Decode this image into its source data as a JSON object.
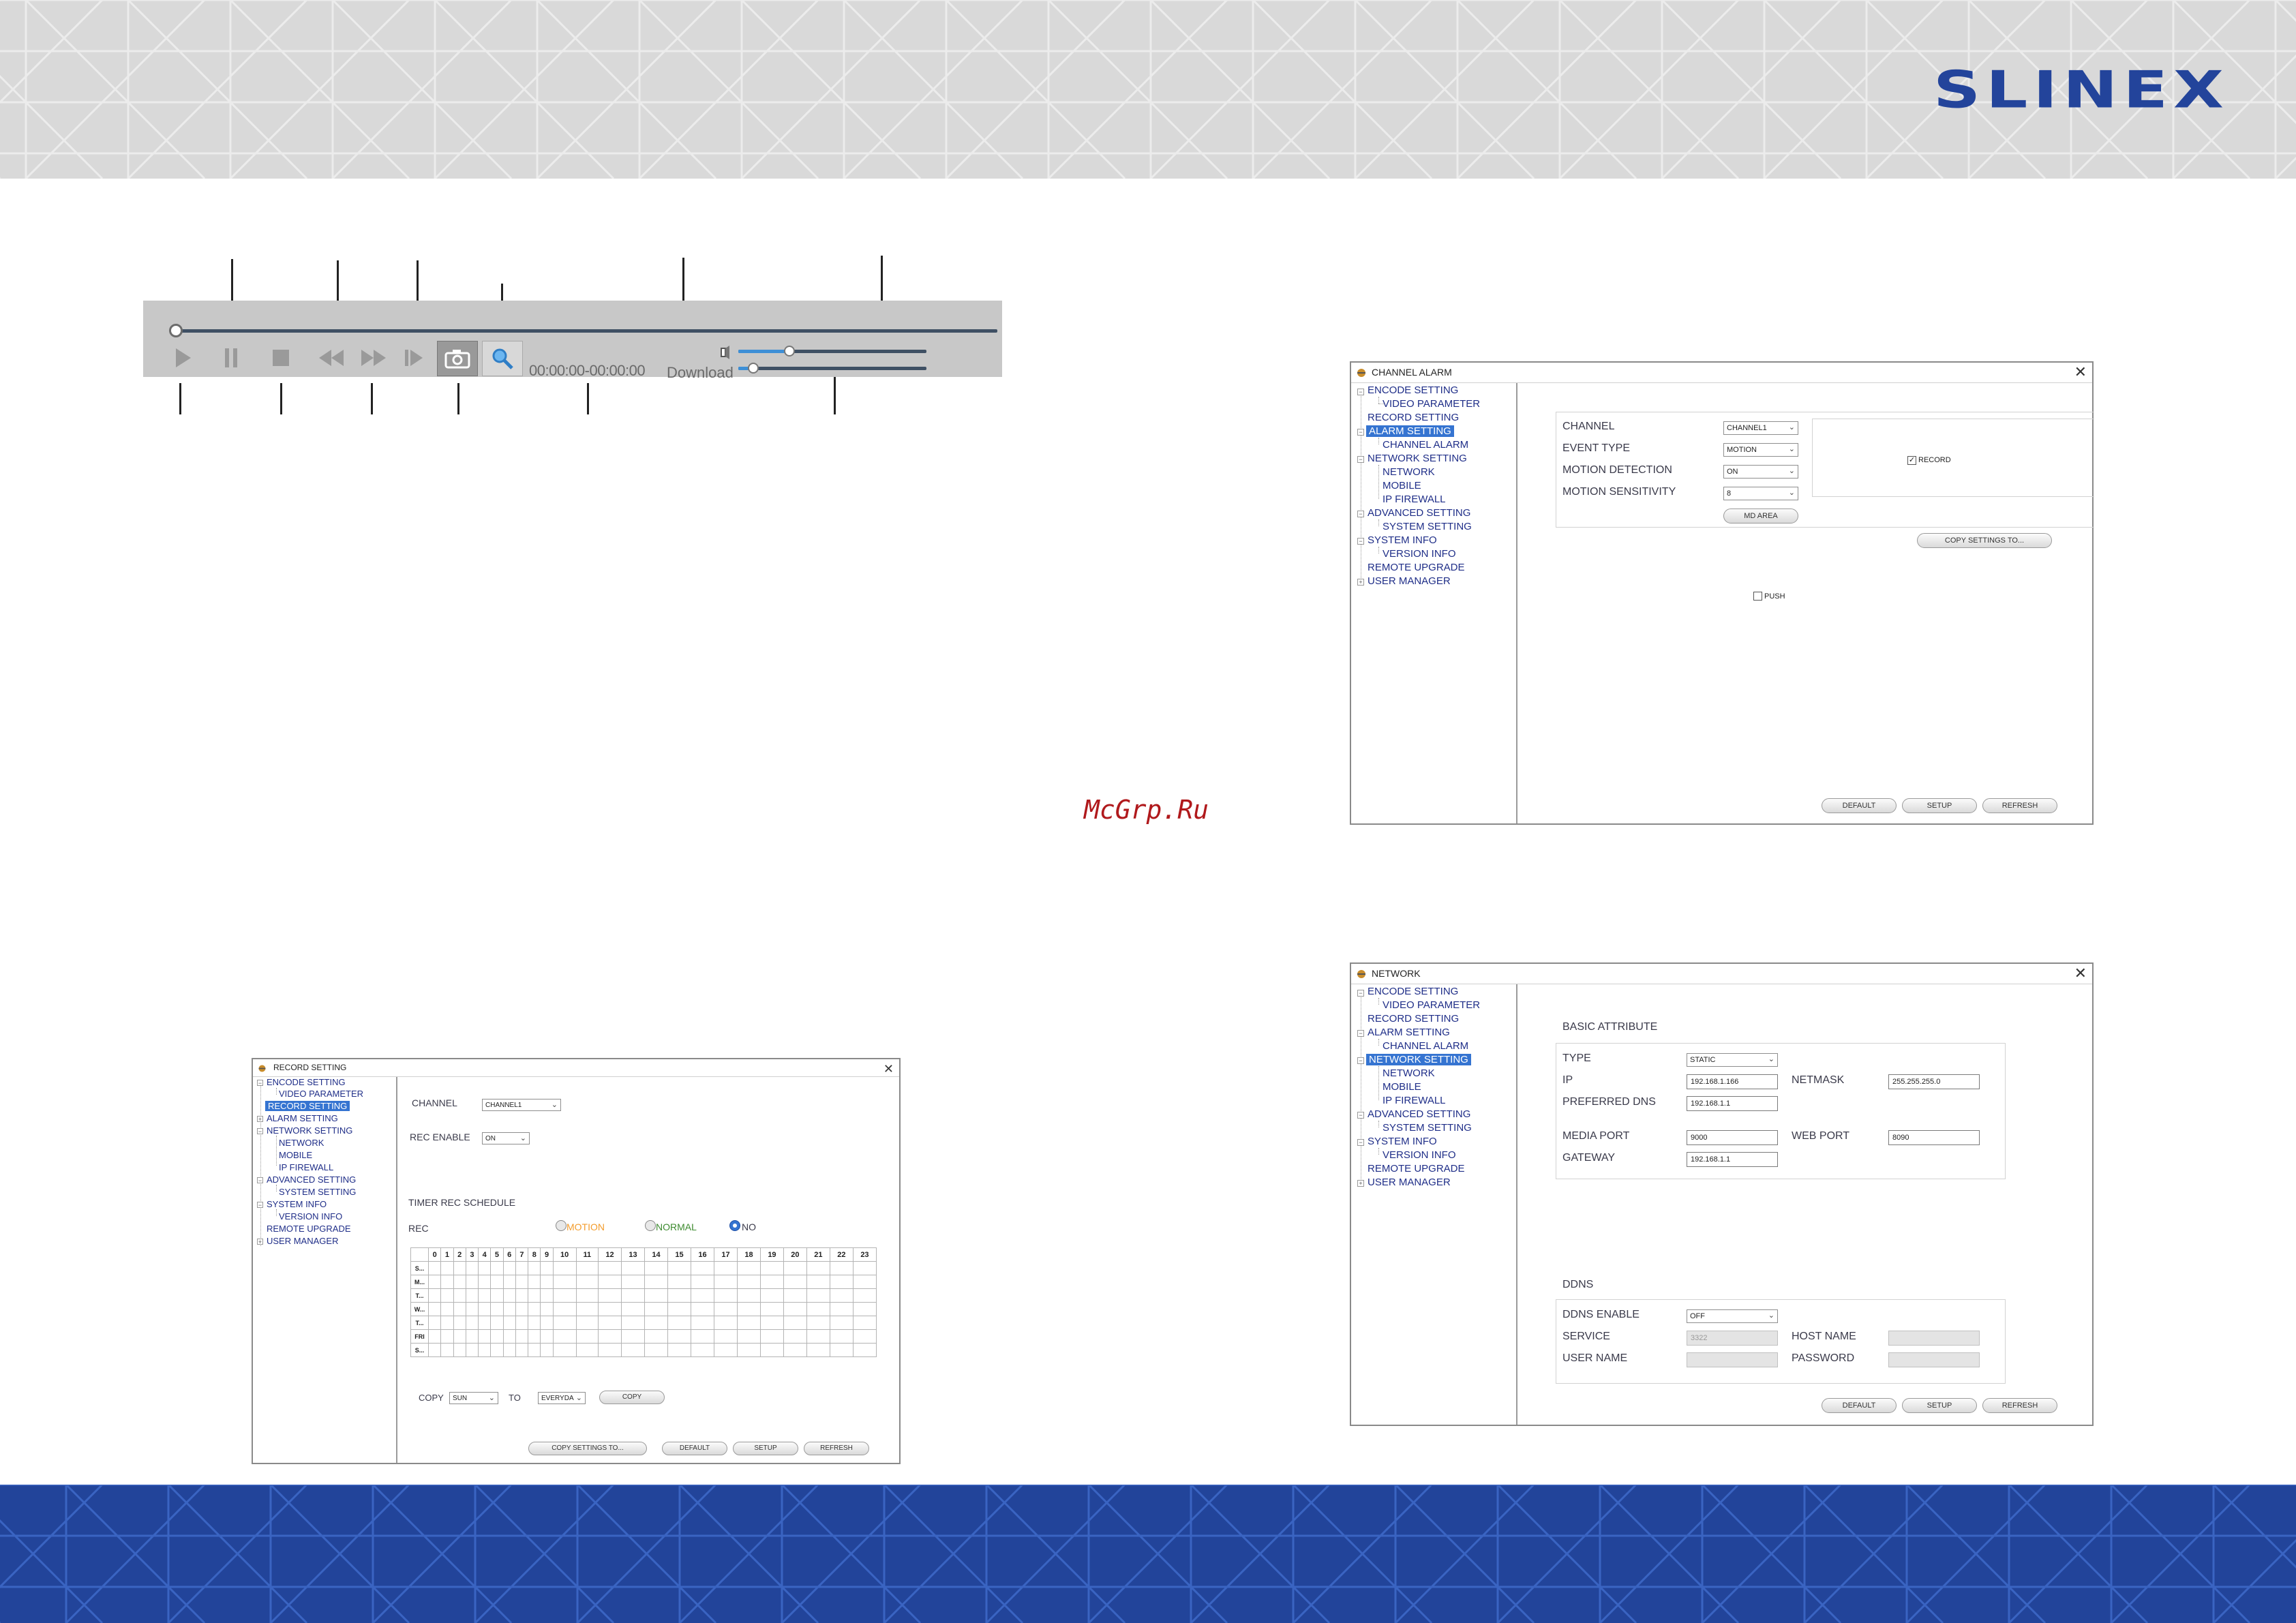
{
  "brand": {
    "logo": "SLINEX",
    "watermark": "McGrp.Ru"
  },
  "colors": {
    "brand_blue": "#23449b",
    "banner_gray": "#d9d9d9",
    "selected": "#3574d1",
    "motion": "#f39c2c",
    "normal": "#3c8a2e"
  },
  "player": {
    "time": "00:00:00-00:00:00",
    "download": "Download",
    "icons": [
      "play-icon",
      "pause-icon",
      "stop-icon",
      "rewind-icon",
      "fast-forward-icon",
      "step-forward-icon",
      "camera-icon",
      "zoom-icon",
      "speaker-icon"
    ],
    "volume_level": 0.27,
    "playback_level": 0.08
  },
  "tree": {
    "encode": "ENCODE SETTING",
    "video_parameter": "VIDEO PARAMETER",
    "record": "RECORD SETTING",
    "alarm": "ALARM SETTING",
    "channel_alarm": "CHANNEL ALARM",
    "network_setting": "NETWORK SETTING",
    "network": "NETWORK",
    "mobile": "MOBILE",
    "ip_firewall": "IP FIREWALL",
    "advanced": "ADVANCED SETTING",
    "system_setting": "SYSTEM SETTING",
    "system_info": "SYSTEM INFO",
    "version_info": "VERSION INFO",
    "remote_upgrade": "REMOTE UPGRADE",
    "user_manager": "USER MANAGER"
  },
  "buttons": {
    "default": "DEFAULT",
    "setup": "SETUP",
    "refresh": "REFRESH",
    "copy_settings": "COPY SETTINGS TO...",
    "copy": "COPY",
    "md_area": "MD AREA"
  },
  "record_window": {
    "title": "RECORD SETTING",
    "channel_label": "CHANNEL",
    "channel_value": "CHANNEL1",
    "rec_enable_label": "REC ENABLE",
    "rec_enable_value": "ON",
    "schedule_title": "TIMER REC SCHEDULE",
    "rec_label": "REC",
    "radio_motion": "MOTION",
    "radio_normal": "NORMAL",
    "radio_no": "NO",
    "hours": [
      "0",
      "1",
      "2",
      "3",
      "4",
      "5",
      "6",
      "7",
      "8",
      "9",
      "10",
      "11",
      "12",
      "13",
      "14",
      "15",
      "16",
      "17",
      "18",
      "19",
      "20",
      "21",
      "22",
      "23"
    ],
    "days": [
      "S...",
      "M...",
      "T...",
      "W...",
      "T...",
      "FRI",
      "S..."
    ],
    "copy_label": "COPY",
    "copy_from": "SUN",
    "to_label": "TO",
    "copy_to": "EVERYDA"
  },
  "alarm_window": {
    "title": "CHANNEL ALARM",
    "channel_label": "CHANNEL",
    "channel_value": "CHANNEL1",
    "event_type_label": "EVENT TYPE",
    "event_type_value": "MOTION",
    "motion_detection_label": "MOTION DETECTION",
    "motion_detection_value": "ON",
    "motion_sensitivity_label": "MOTION  SENSITIVITY",
    "motion_sensitivity_value": "8",
    "record_label": "RECORD",
    "push_label": "PUSH"
  },
  "network_window": {
    "title": "NETWORK",
    "basic_title": "BASIC ATTRIBUTE",
    "type_label": "TYPE",
    "type_value": "STATIC",
    "ip_label": "IP",
    "ip_value": "192.168.1.166",
    "netmask_label": "NETMASK",
    "netmask_value": "255.255.255.0",
    "dns_label": "PREFERRED DNS",
    "dns_value": "192.168.1.1",
    "media_port_label": "MEDIA PORT",
    "media_port_value": "9000",
    "web_port_label": "WEB PORT",
    "web_port_value": "8090",
    "gateway_label": "GATEWAY",
    "gateway_value": "192.168.1.1",
    "ddns_title": "DDNS",
    "ddns_enable_label": "DDNS ENABLE",
    "ddns_enable_value": "OFF",
    "service_label": "SERVICE",
    "service_value": "3322",
    "host_name_label": "HOST NAME",
    "user_name_label": "USER NAME",
    "password_label": "PASSWORD"
  }
}
